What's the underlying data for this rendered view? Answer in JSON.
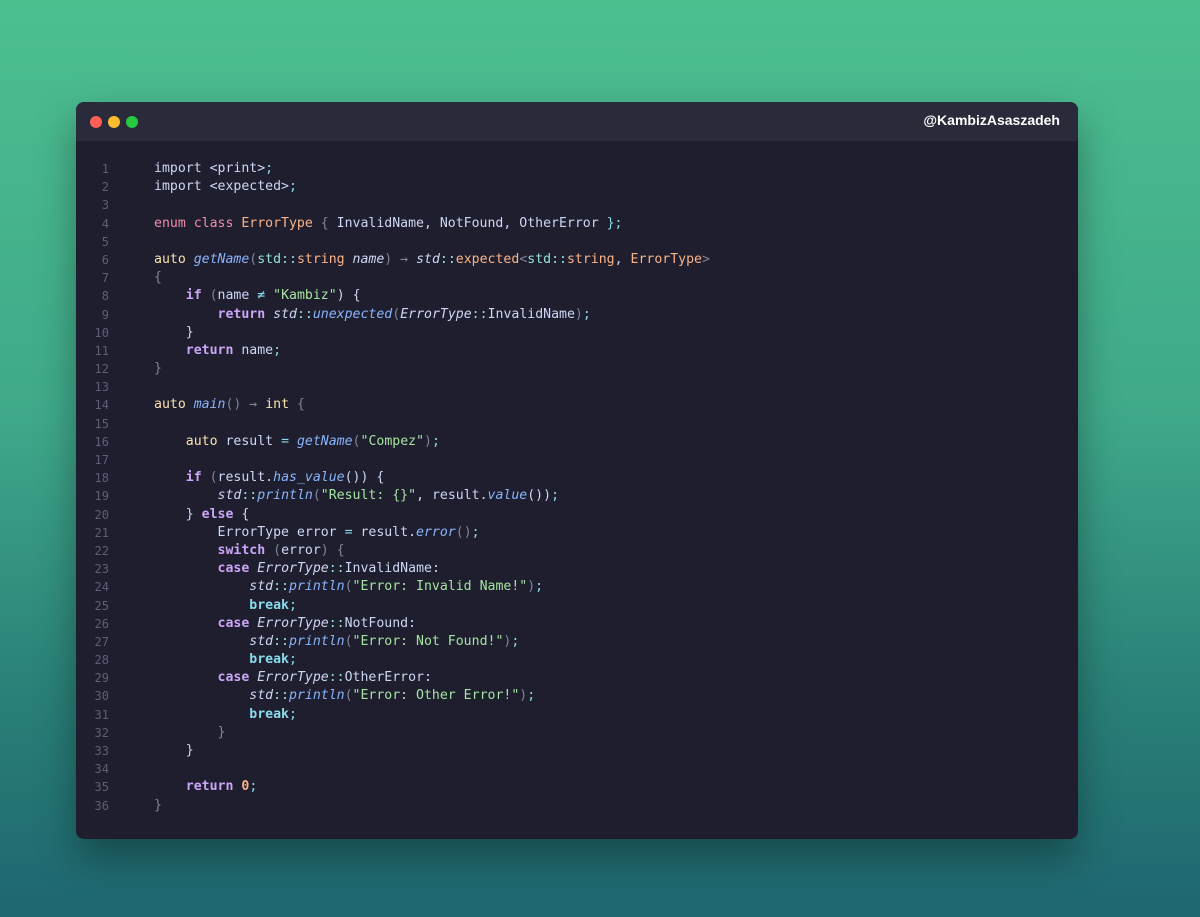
{
  "window": {
    "handle": "@KambizAsaszadeh",
    "colors": {
      "close": "#ff5f57",
      "minimize": "#febc2e",
      "maximize": "#28c840"
    }
  },
  "code_lines": [
    [
      [
        "import <print>",
        "t-var"
      ],
      [
        ";",
        "t-op"
      ]
    ],
    [
      [
        "import <expected>",
        "t-var"
      ],
      [
        ";",
        "t-op"
      ]
    ],
    [],
    [
      [
        "enum class ",
        "t-kw"
      ],
      [
        "ErrorType",
        "t-type"
      ],
      [
        " { ",
        "t-pun"
      ],
      [
        "InvalidName, NotFound, OtherError",
        "t-var"
      ],
      [
        " };",
        "t-op"
      ]
    ],
    [],
    [
      [
        "auto ",
        "t-auto"
      ],
      [
        "getName",
        "t-fn"
      ],
      [
        "(",
        "t-pun"
      ],
      [
        "std::",
        "t-nsc"
      ],
      [
        "string ",
        "t-type"
      ],
      [
        "name",
        "t-param"
      ],
      [
        ") ",
        "t-pun"
      ],
      [
        "→ ",
        "t-pun"
      ],
      [
        "std",
        "t-ns"
      ],
      [
        "::",
        "t-nsc"
      ],
      [
        "expected",
        "t-type"
      ],
      [
        "<",
        "t-pun"
      ],
      [
        "std::",
        "t-nsc"
      ],
      [
        "string",
        "t-type"
      ],
      [
        ", ",
        "t-var"
      ],
      [
        "ErrorType",
        "t-type"
      ],
      [
        ">",
        "t-pun"
      ]
    ],
    [
      [
        "{",
        "t-pun"
      ]
    ],
    [
      [
        "    ",
        "t-var"
      ],
      [
        "if",
        "t-ctl"
      ],
      [
        " (",
        "t-pun"
      ],
      [
        "name ",
        "t-var"
      ],
      [
        "≠",
        "t-op"
      ],
      [
        " ",
        "t-var"
      ],
      [
        "\"Kambiz\"",
        "t-str"
      ],
      [
        ") {",
        "t-var"
      ]
    ],
    [
      [
        "        ",
        "t-var"
      ],
      [
        "return",
        "t-ctl"
      ],
      [
        " ",
        "t-var"
      ],
      [
        "std",
        "t-ns"
      ],
      [
        "::",
        "t-nsc"
      ],
      [
        "unexpected",
        "t-fn"
      ],
      [
        "(",
        "t-pun"
      ],
      [
        "ErrorType",
        "t-etype"
      ],
      [
        "::",
        "t-nsc"
      ],
      [
        "InvalidName",
        "t-var"
      ],
      [
        ")",
        "t-pun"
      ],
      [
        ";",
        "t-op"
      ]
    ],
    [
      [
        "    }",
        "t-var"
      ]
    ],
    [
      [
        "    ",
        "t-var"
      ],
      [
        "return",
        "t-ctl"
      ],
      [
        " name",
        "t-var"
      ],
      [
        ";",
        "t-op"
      ]
    ],
    [
      [
        "}",
        "t-pun"
      ]
    ],
    [],
    [
      [
        "auto ",
        "t-auto"
      ],
      [
        "main",
        "t-fn"
      ],
      [
        "() ",
        "t-pun"
      ],
      [
        "→ ",
        "t-pun"
      ],
      [
        "int",
        "t-int"
      ],
      [
        " {",
        "t-pun"
      ]
    ],
    [],
    [
      [
        "    ",
        "t-var"
      ],
      [
        "auto",
        "t-auto"
      ],
      [
        " result ",
        "t-var"
      ],
      [
        "=",
        "t-op"
      ],
      [
        " ",
        "t-var"
      ],
      [
        "getName",
        "t-fn"
      ],
      [
        "(",
        "t-pun"
      ],
      [
        "\"Compez\"",
        "t-str"
      ],
      [
        ")",
        "t-pun"
      ],
      [
        ";",
        "t-op"
      ]
    ],
    [],
    [
      [
        "    ",
        "t-var"
      ],
      [
        "if",
        "t-ctl"
      ],
      [
        " (",
        "t-pun"
      ],
      [
        "result.",
        "t-var"
      ],
      [
        "has_value",
        "t-fn"
      ],
      [
        "()) {",
        "t-var"
      ]
    ],
    [
      [
        "        ",
        "t-var"
      ],
      [
        "std",
        "t-ns"
      ],
      [
        "::",
        "t-nsc"
      ],
      [
        "println",
        "t-fn"
      ],
      [
        "(",
        "t-pun"
      ],
      [
        "\"Result: {}\"",
        "t-str"
      ],
      [
        ", result.",
        "t-var"
      ],
      [
        "value",
        "t-fn"
      ],
      [
        "())",
        "t-var"
      ],
      [
        ";",
        "t-op"
      ]
    ],
    [
      [
        "    } ",
        "t-var"
      ],
      [
        "else",
        "t-ctl"
      ],
      [
        " {",
        "t-var"
      ]
    ],
    [
      [
        "        ErrorType error ",
        "t-var"
      ],
      [
        "=",
        "t-op"
      ],
      [
        " result.",
        "t-var"
      ],
      [
        "error",
        "t-fn"
      ],
      [
        "()",
        "t-pun"
      ],
      [
        ";",
        "t-op"
      ]
    ],
    [
      [
        "        ",
        "t-var"
      ],
      [
        "switch",
        "t-ctl"
      ],
      [
        " (",
        "t-pun"
      ],
      [
        "error",
        "t-var"
      ],
      [
        ") {",
        "t-pun"
      ]
    ],
    [
      [
        "        ",
        "t-var"
      ],
      [
        "case",
        "t-ctl"
      ],
      [
        " ",
        "t-var"
      ],
      [
        "ErrorType",
        "t-etype"
      ],
      [
        "::",
        "t-nsc"
      ],
      [
        "InvalidName:",
        "t-var"
      ]
    ],
    [
      [
        "            ",
        "t-var"
      ],
      [
        "std",
        "t-ns"
      ],
      [
        "::",
        "t-nsc"
      ],
      [
        "println",
        "t-fn"
      ],
      [
        "(",
        "t-pun"
      ],
      [
        "\"Error: Invalid Name!\"",
        "t-str"
      ],
      [
        ")",
        "t-pun"
      ],
      [
        ";",
        "t-op"
      ]
    ],
    [
      [
        "            ",
        "t-var"
      ],
      [
        "break",
        "t-brk"
      ],
      [
        ";",
        "t-op"
      ]
    ],
    [
      [
        "        ",
        "t-var"
      ],
      [
        "case",
        "t-ctl"
      ],
      [
        " ",
        "t-var"
      ],
      [
        "ErrorType",
        "t-etype"
      ],
      [
        "::",
        "t-nsc"
      ],
      [
        "NotFound:",
        "t-var"
      ]
    ],
    [
      [
        "            ",
        "t-var"
      ],
      [
        "std",
        "t-ns"
      ],
      [
        "::",
        "t-nsc"
      ],
      [
        "println",
        "t-fn"
      ],
      [
        "(",
        "t-pun"
      ],
      [
        "\"Error: Not Found!\"",
        "t-str"
      ],
      [
        ")",
        "t-pun"
      ],
      [
        ";",
        "t-op"
      ]
    ],
    [
      [
        "            ",
        "t-var"
      ],
      [
        "break",
        "t-brk"
      ],
      [
        ";",
        "t-op"
      ]
    ],
    [
      [
        "        ",
        "t-var"
      ],
      [
        "case",
        "t-ctl"
      ],
      [
        " ",
        "t-var"
      ],
      [
        "ErrorType",
        "t-etype"
      ],
      [
        "::",
        "t-nsc"
      ],
      [
        "OtherError:",
        "t-var"
      ]
    ],
    [
      [
        "            ",
        "t-var"
      ],
      [
        "std",
        "t-ns"
      ],
      [
        "::",
        "t-nsc"
      ],
      [
        "println",
        "t-fn"
      ],
      [
        "(",
        "t-pun"
      ],
      [
        "\"Error: Other Error!\"",
        "t-str"
      ],
      [
        ")",
        "t-pun"
      ],
      [
        ";",
        "t-op"
      ]
    ],
    [
      [
        "            ",
        "t-var"
      ],
      [
        "break",
        "t-brk"
      ],
      [
        ";",
        "t-op"
      ]
    ],
    [
      [
        "        }",
        "t-pun"
      ]
    ],
    [
      [
        "    }",
        "t-var"
      ]
    ],
    [],
    [
      [
        "    ",
        "t-var"
      ],
      [
        "return",
        "t-ctl"
      ],
      [
        " ",
        "t-var"
      ],
      [
        "0",
        "t-num"
      ],
      [
        ";",
        "t-op"
      ]
    ],
    [
      [
        "}",
        "t-pun"
      ]
    ]
  ]
}
